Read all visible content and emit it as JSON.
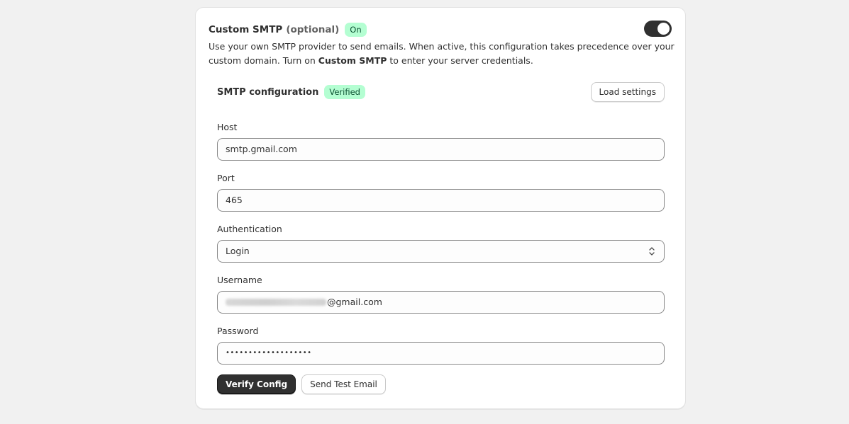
{
  "smtp": {
    "title": "Custom SMTP",
    "optional_label": "(optional)",
    "status_badge": "On",
    "toggle_on": true,
    "description_part1": "Use your own SMTP provider to send emails. When active, this configuration takes precedence over your custom domain. Turn on ",
    "description_bold": "Custom SMTP",
    "description_part2": " to enter your server credentials."
  },
  "config": {
    "title": "SMTP configuration",
    "verified_badge": "Verified",
    "load_settings_label": "Load settings"
  },
  "fields": {
    "host": {
      "label": "Host",
      "value": "smtp.gmail.com"
    },
    "port": {
      "label": "Port",
      "value": "465"
    },
    "authentication": {
      "label": "Authentication",
      "value": "Login"
    },
    "username": {
      "label": "Username",
      "value_suffix": "@gmail.com"
    },
    "password": {
      "label": "Password",
      "value": "•••••••••••••••••••"
    }
  },
  "actions": {
    "verify_label": "Verify Config",
    "send_test_label": "Send Test Email"
  },
  "colors": {
    "accent_dark": "#303030",
    "badge_green_bg": "#b4fed2",
    "badge_green_text": "#0c5132",
    "page_bg": "#f1f1f1"
  },
  "icons": {
    "select": "select-arrows-icon",
    "toggle": "toggle-switch"
  }
}
